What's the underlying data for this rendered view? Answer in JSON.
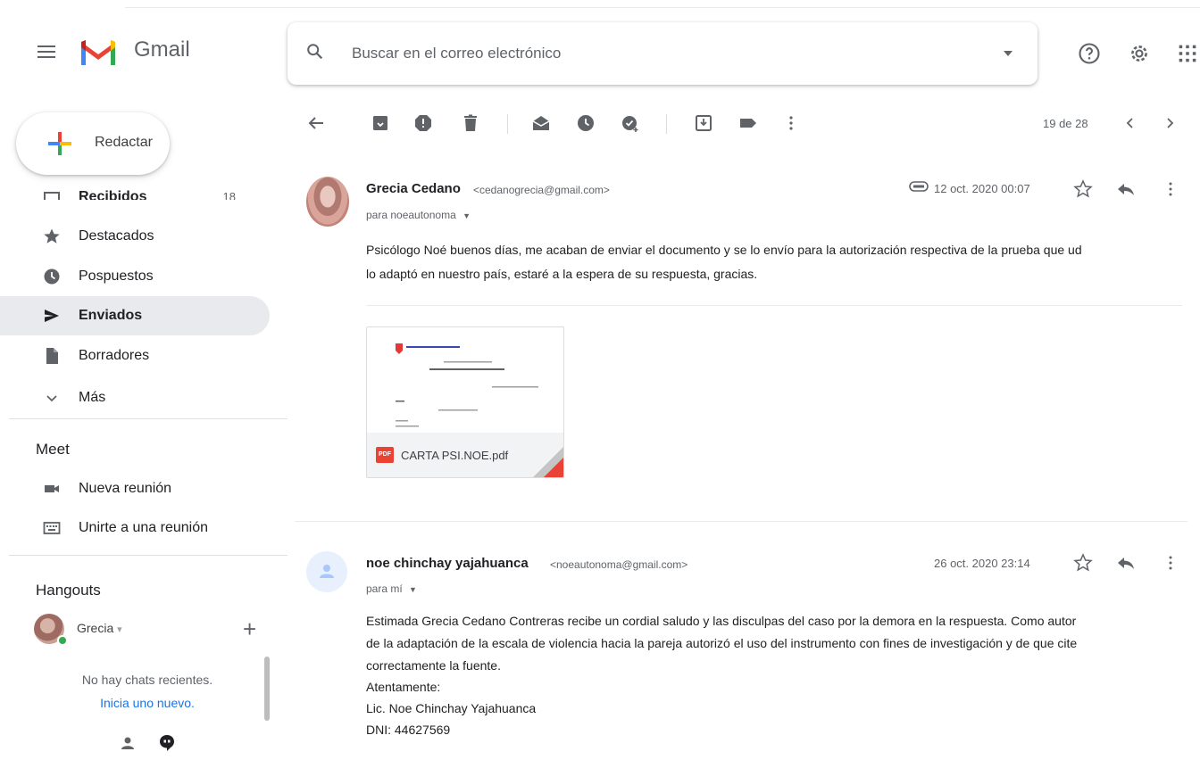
{
  "app": {
    "name": "Gmail"
  },
  "search": {
    "placeholder": "Buscar en el correo electrónico"
  },
  "compose": {
    "label": "Redactar"
  },
  "sidebar": {
    "items": [
      {
        "label": "Recibidos",
        "count": "18"
      },
      {
        "label": "Destacados"
      },
      {
        "label": "Pospuestos"
      },
      {
        "label": "Enviados"
      },
      {
        "label": "Borradores"
      },
      {
        "label": "Más"
      }
    ]
  },
  "meet": {
    "title": "Meet",
    "items": [
      {
        "label": "Nueva reunión"
      },
      {
        "label": "Unirte a una reunión"
      }
    ]
  },
  "hangouts": {
    "title": "Hangouts",
    "user": "Grecia",
    "user_caret": "▾",
    "no_chats": "No hay chats recientes.",
    "start_new": "Inicia uno nuevo."
  },
  "pager": {
    "text": "19 de 28"
  },
  "messages": [
    {
      "sender": "Grecia Cedano",
      "email": "<cedanogrecia@gmail.com>",
      "recipient": "para noeautonoma",
      "date": "12 oct. 2020 00:07",
      "body": [
        "Psicólogo Noé buenos días, me acaban de enviar el documento y se lo envío para la autorización respectiva de la prueba que ud",
        "lo adaptó en nuestro país, estaré a la espera de su respuesta, gracias."
      ],
      "attachment": {
        "type_label": "PDF",
        "name": "CARTA PSI.NOE.pdf"
      }
    },
    {
      "sender": "noe chinchay yajahuanca",
      "email": "<noeautonoma@gmail.com>",
      "recipient": "para mí",
      "date": "26 oct. 2020 23:14",
      "body": [
        "Estimada Grecia Cedano Contreras recibe un cordial saludo y las disculpas del caso por la demora en la respuesta. Como autor",
        "de la adaptación  de la escala de violencia hacia la pareja autorizó el uso del instrumento con fines de investigación y de que cite",
        "correctamente la fuente.",
        "Atentamente:",
        "Lic. Noe Chinchay Yajahuanca",
        "DNI: 44627569"
      ]
    }
  ],
  "colors": {
    "accent": "#1a73e8",
    "red": "#ea4335",
    "icon": "#5f6368"
  }
}
